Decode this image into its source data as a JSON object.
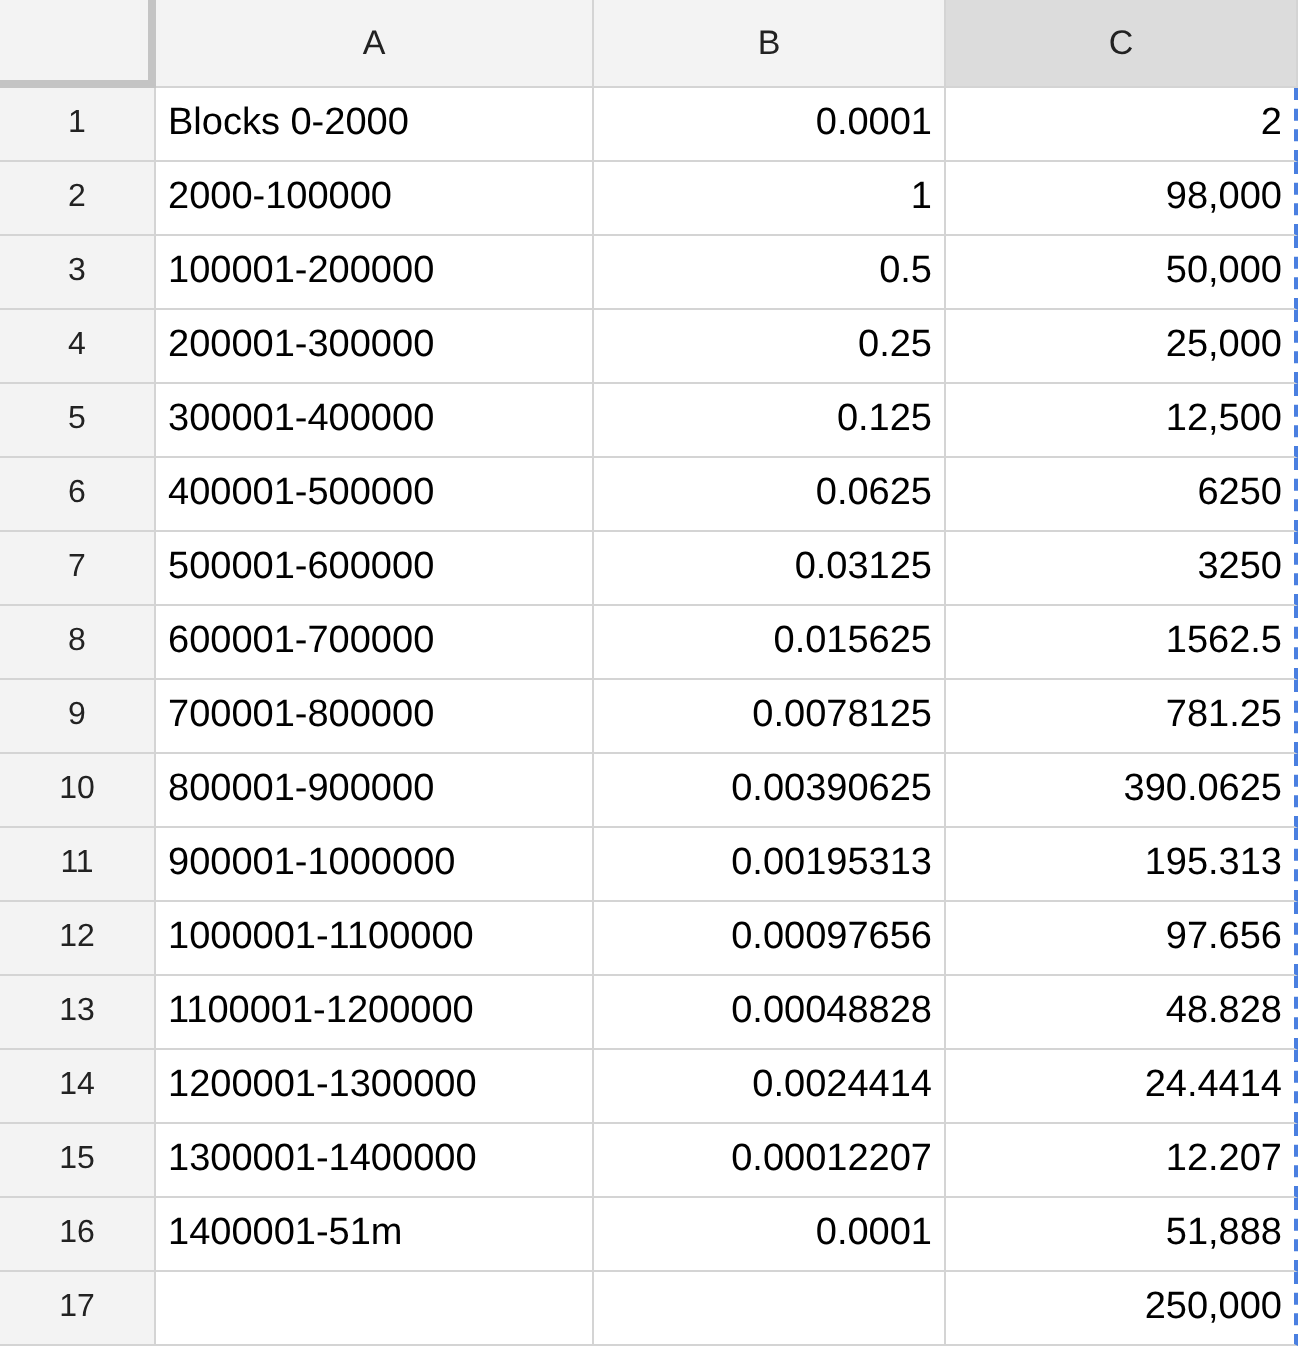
{
  "columns": [
    {
      "label": "A",
      "selected": false,
      "copied": false
    },
    {
      "label": "B",
      "selected": false,
      "copied": false
    },
    {
      "label": "C",
      "selected": true,
      "copied": true
    }
  ],
  "rows": [
    {
      "number": "1",
      "cells": [
        "Blocks 0-2000",
        "0.0001",
        "2"
      ]
    },
    {
      "number": "2",
      "cells": [
        "2000-100000",
        "1",
        "98,000"
      ]
    },
    {
      "number": "3",
      "cells": [
        "100001-200000",
        "0.5",
        "50,000"
      ]
    },
    {
      "number": "4",
      "cells": [
        "200001-300000",
        "0.25",
        "25,000"
      ]
    },
    {
      "number": "5",
      "cells": [
        "300001-400000",
        "0.125",
        "12,500"
      ]
    },
    {
      "number": "6",
      "cells": [
        "400001-500000",
        "0.0625",
        "6250"
      ]
    },
    {
      "number": "7",
      "cells": [
        "500001-600000",
        "0.03125",
        "3250"
      ]
    },
    {
      "number": "8",
      "cells": [
        "600001-700000",
        "0.015625",
        "1562.5"
      ]
    },
    {
      "number": "9",
      "cells": [
        "700001-800000",
        "0.0078125",
        "781.25"
      ]
    },
    {
      "number": "10",
      "cells": [
        "800001-900000",
        "0.00390625",
        "390.0625"
      ]
    },
    {
      "number": "11",
      "cells": [
        "900001-1000000",
        "0.00195313",
        "195.313"
      ]
    },
    {
      "number": "12",
      "cells": [
        "1000001-1100000",
        "0.00097656",
        "97.656"
      ]
    },
    {
      "number": "13",
      "cells": [
        "1100001-1200000",
        "0.00048828",
        "48.828"
      ]
    },
    {
      "number": "14",
      "cells": [
        "1200001-1300000",
        "0.0024414",
        "24.4414"
      ]
    },
    {
      "number": "15",
      "cells": [
        "1300001-1400000",
        "0.00012207",
        "12.207"
      ]
    },
    {
      "number": "16",
      "cells": [
        "1400001-51m",
        "0.0001",
        "51,888"
      ]
    },
    {
      "number": "17",
      "cells": [
        null,
        null,
        "250,000"
      ]
    }
  ]
}
